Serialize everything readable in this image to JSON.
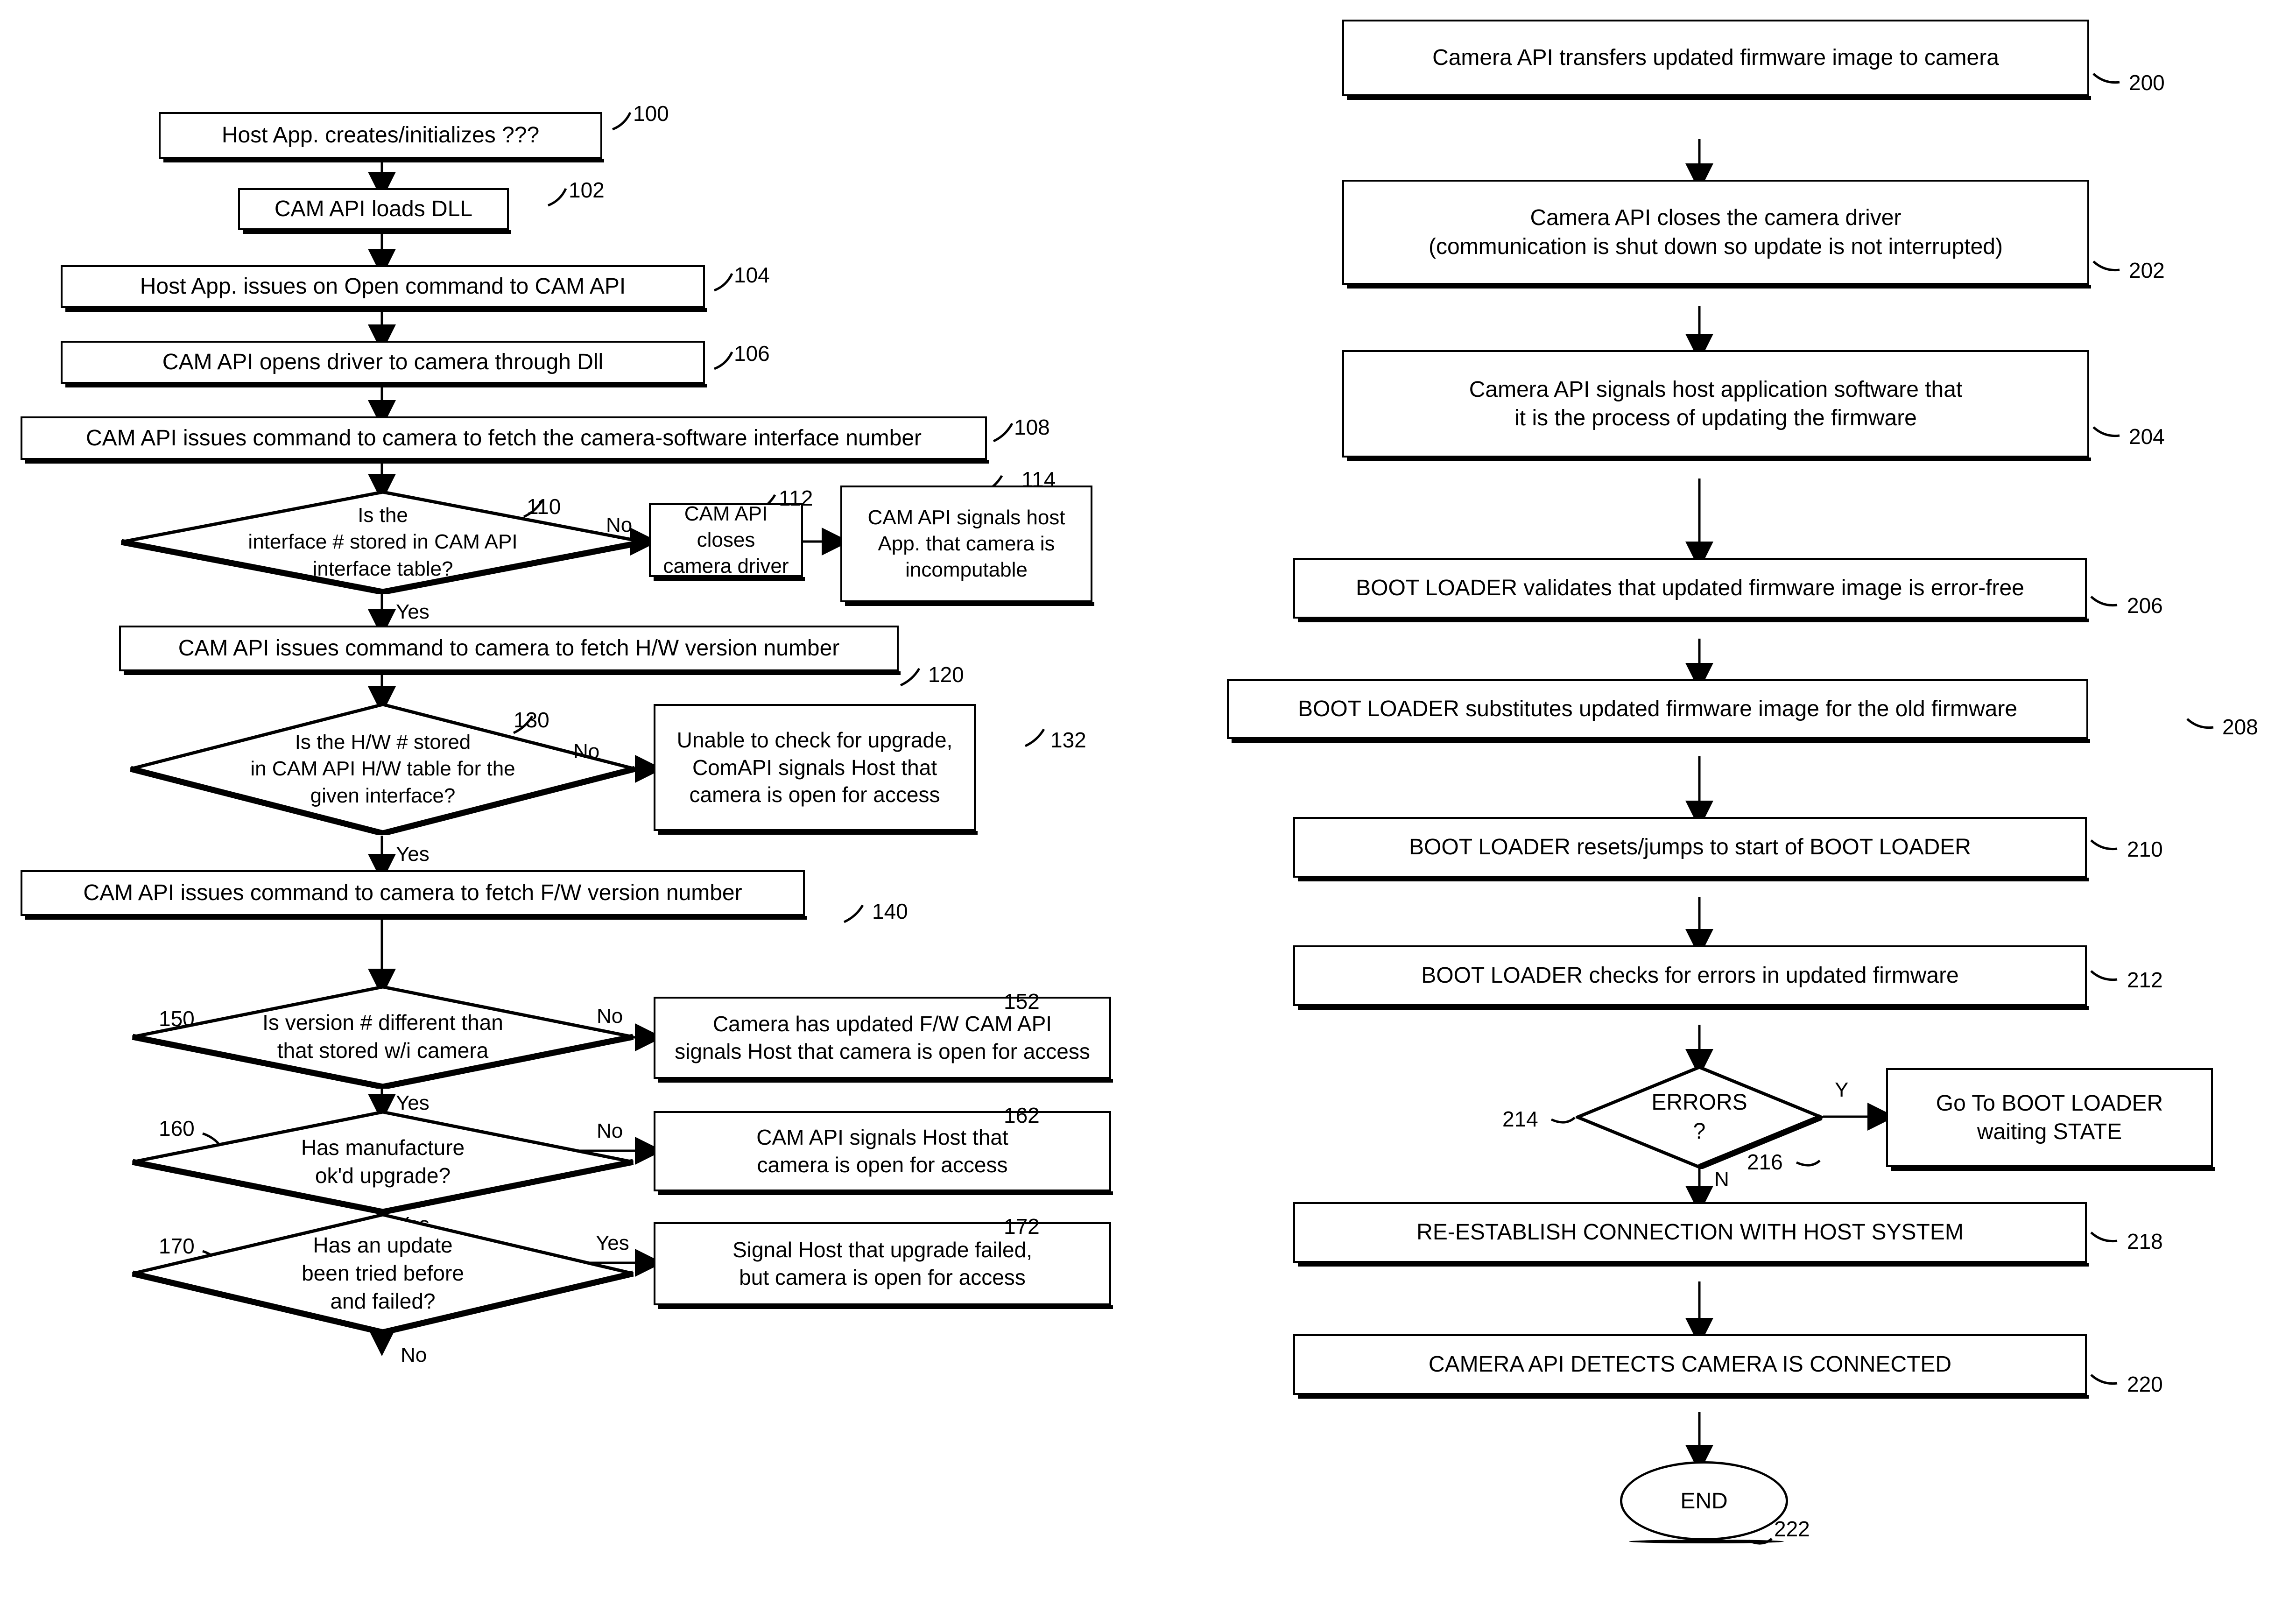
{
  "figure": {
    "type": "patent-flowchart",
    "panels": [
      "left-flowchart",
      "right-flowchart"
    ]
  },
  "left": {
    "nodes": [
      {
        "ref": "100",
        "shape": "process",
        "text": "Host App. creates/initializes  ???"
      },
      {
        "ref": "102",
        "shape": "process",
        "text": "CAM API loads DLL"
      },
      {
        "ref": "104",
        "shape": "process",
        "text": "Host App. issues on Open command to CAM API"
      },
      {
        "ref": "106",
        "shape": "process",
        "text": "CAM API opens driver to camera through Dll"
      },
      {
        "ref": "108",
        "shape": "process",
        "text": "CAM API issues command to camera to fetch the camera-software interface number"
      },
      {
        "ref": "110",
        "shape": "decision",
        "text": "Is the\ninterface # stored in CAM API\ninterface table?"
      },
      {
        "ref": "112",
        "shape": "process",
        "text": "CAM API closes\ncamera driver"
      },
      {
        "ref": "114",
        "shape": "process",
        "text": "CAM API signals host\nApp. that camera is\nincomputable"
      },
      {
        "ref": "120",
        "shape": "process",
        "text": "CAM API issues command to camera to fetch H/W version number"
      },
      {
        "ref": "130",
        "shape": "decision",
        "text": "Is the H/W # stored\nin CAM API H/W table for the\ngiven interface?"
      },
      {
        "ref": "132",
        "shape": "process",
        "text": "Unable to check for upgrade,\nComAPI signals Host that\ncamera is open for access"
      },
      {
        "ref": "140",
        "shape": "process",
        "text": "CAM API issues command to camera to fetch F/W version number"
      },
      {
        "ref": "150",
        "shape": "decision",
        "text": "Is version # different than\nthat stored w/i camera"
      },
      {
        "ref": "152",
        "shape": "process",
        "text": "Camera has updated F/W CAM API\nsignals Host that camera is open for access"
      },
      {
        "ref": "160",
        "shape": "decision",
        "text": "Has manufacture\nok'd upgrade?"
      },
      {
        "ref": "162",
        "shape": "process",
        "text": "CAM API signals Host that\ncamera is open for access"
      },
      {
        "ref": "170",
        "shape": "decision",
        "text": "Has an update\nbeen tried before\nand failed?"
      },
      {
        "ref": "172",
        "shape": "process",
        "text": "Signal Host that upgrade failed,\nbut camera is open for access"
      }
    ],
    "edge_labels": {
      "d110_no": "No",
      "d110_yes": "Yes",
      "d130_no": "No",
      "d130_yes": "Yes",
      "d150_no": "No",
      "d150_yes": "Yes",
      "d160_no": "No",
      "d160_yes": "Yes",
      "d170_yes": "Yes",
      "d170_no": "No"
    }
  },
  "right": {
    "nodes": [
      {
        "ref": "200",
        "shape": "process",
        "text": "Camera API transfers updated firmware image to camera"
      },
      {
        "ref": "202",
        "shape": "process",
        "text": "Camera API closes the camera driver\n(communication is shut down so update is not interrupted)"
      },
      {
        "ref": "204",
        "shape": "process",
        "text": "Camera API signals host application software that\nit is the process of updating the firmware"
      },
      {
        "ref": "206",
        "shape": "process",
        "text": "BOOT LOADER validates that updated firmware image is error-free"
      },
      {
        "ref": "208",
        "shape": "process",
        "text": "BOOT LOADER substitutes updated firmware image for the old firmware"
      },
      {
        "ref": "210",
        "shape": "process",
        "text": "BOOT LOADER resets/jumps to start of BOOT LOADER"
      },
      {
        "ref": "212",
        "shape": "process",
        "text": "BOOT LOADER checks for errors in updated firmware"
      },
      {
        "ref": "214",
        "shape": "decision",
        "text": "ERRORS\n?"
      },
      {
        "ref": "216",
        "shape": "process",
        "text": "Go To BOOT LOADER\nwaiting STATE"
      },
      {
        "ref": "218",
        "shape": "process",
        "text": "RE-ESTABLISH CONNECTION WITH HOST SYSTEM"
      },
      {
        "ref": "220",
        "shape": "process",
        "text": "CAMERA API DETECTS CAMERA IS CONNECTED"
      },
      {
        "ref": "222",
        "shape": "terminator",
        "text": "END"
      }
    ],
    "edge_labels": {
      "d214_y": "Y",
      "d214_n": "N"
    }
  },
  "colors": {
    "ink": "#000000",
    "paper": "#ffffff"
  }
}
